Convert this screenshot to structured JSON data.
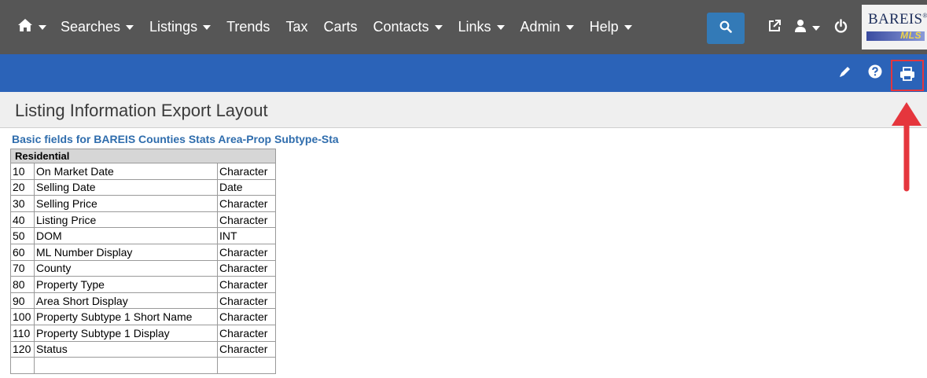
{
  "nav": {
    "items": [
      {
        "label": "Searches",
        "dropdown": true
      },
      {
        "label": "Listings",
        "dropdown": true
      },
      {
        "label": "Trends",
        "dropdown": false
      },
      {
        "label": "Tax",
        "dropdown": false
      },
      {
        "label": "Carts",
        "dropdown": false
      },
      {
        "label": "Contacts",
        "dropdown": true
      },
      {
        "label": "Links",
        "dropdown": true
      },
      {
        "label": "Admin",
        "dropdown": true
      },
      {
        "label": "Help",
        "dropdown": true
      }
    ],
    "logo_text": "BAREIS",
    "logo_reg": "®",
    "logo_sub": "MLS"
  },
  "page": {
    "title": "Listing Information Export Layout",
    "subtitle": "Basic fields for BAREIS Counties Stats Area-Prop Subtype-Sta"
  },
  "table": {
    "section_header": "Residential",
    "rows": [
      {
        "num": "10",
        "name": "On Market Date",
        "type": "Character"
      },
      {
        "num": "20",
        "name": "Selling Date",
        "type": "Date"
      },
      {
        "num": "30",
        "name": "Selling Price",
        "type": "Character"
      },
      {
        "num": "40",
        "name": "Listing Price",
        "type": "Character"
      },
      {
        "num": "50",
        "name": "DOM",
        "type": "INT"
      },
      {
        "num": "60",
        "name": "ML Number Display",
        "type": "Character"
      },
      {
        "num": "70",
        "name": "County",
        "type": "Character"
      },
      {
        "num": "80",
        "name": "Property Type",
        "type": "Character"
      },
      {
        "num": "90",
        "name": "Area Short Display",
        "type": "Character"
      },
      {
        "num": "100",
        "name": "Property Subtype 1 Short Name",
        "type": "Character"
      },
      {
        "num": "110",
        "name": "Property Subtype 1 Display",
        "type": "Character"
      },
      {
        "num": "120",
        "name": "Status",
        "type": "Character"
      },
      {
        "num": "",
        "name": "",
        "type": ""
      }
    ]
  },
  "colors": {
    "nav_bg": "#565656",
    "toolbar_bg": "#2b63b8",
    "search_btn": "#337ab7",
    "highlight": "#e5363d",
    "subtitle": "#2f6dad"
  },
  "icons": {
    "home": "home-icon",
    "search": "search-icon",
    "external_link": "external-link-icon",
    "user": "user-icon",
    "power": "power-icon",
    "edit": "pencil-icon",
    "help": "question-icon",
    "print": "print-icon"
  }
}
